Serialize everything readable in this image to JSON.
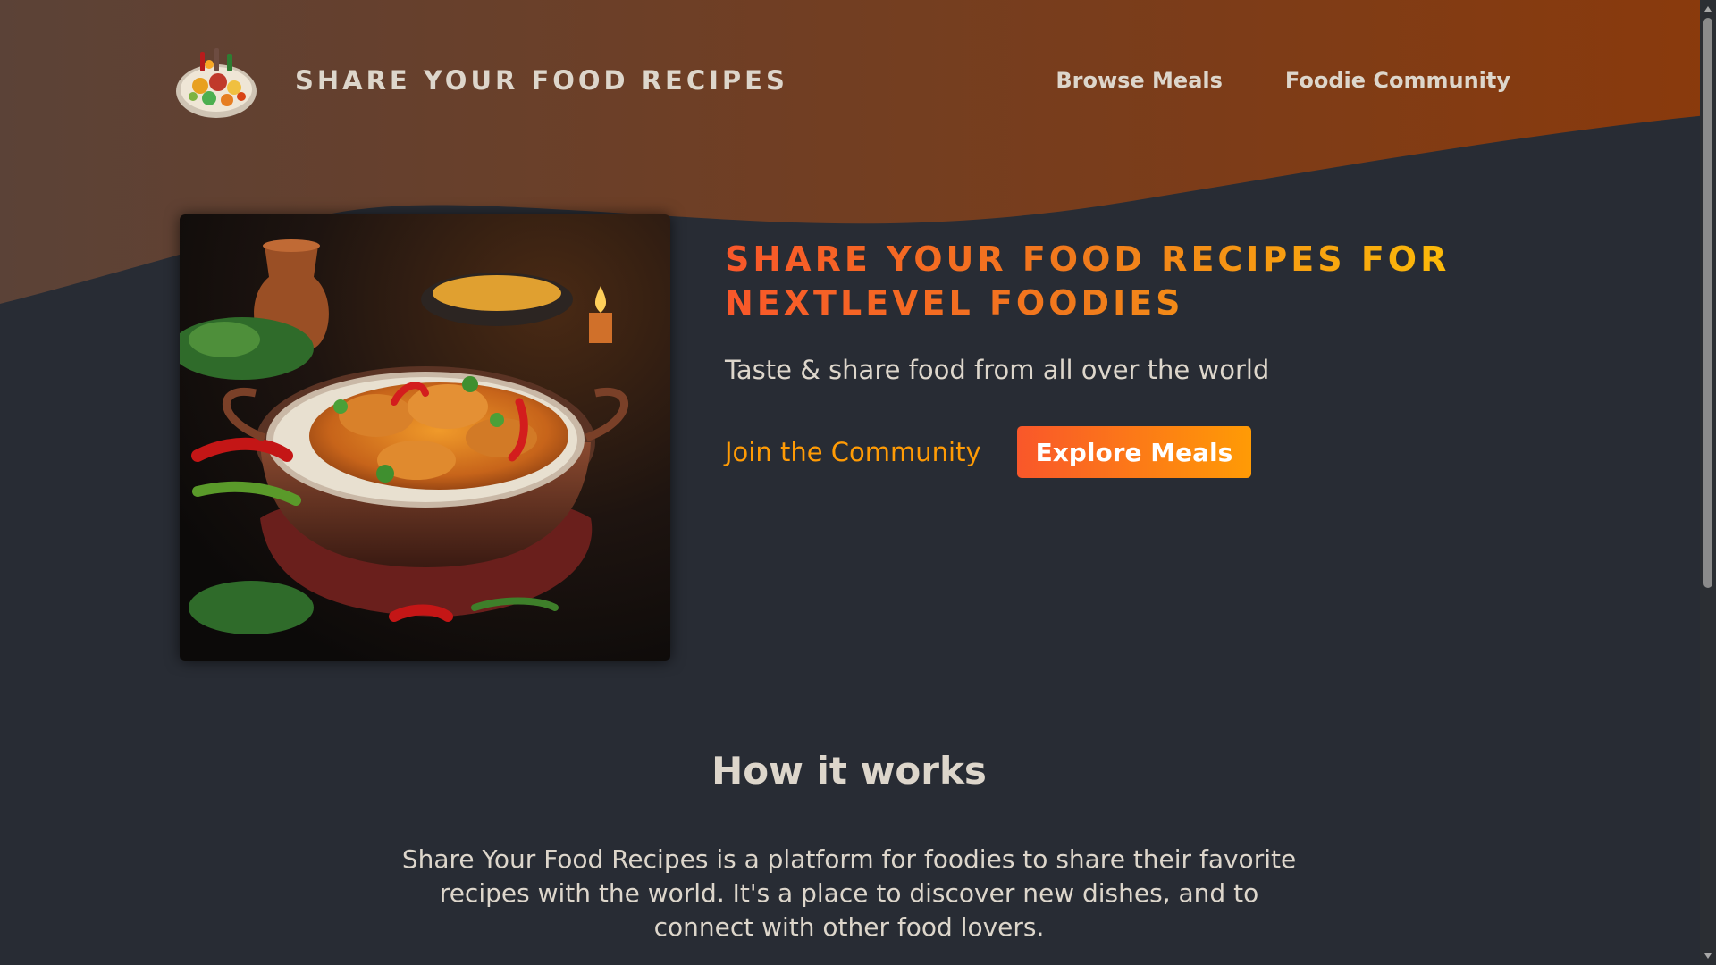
{
  "header": {
    "logo_alt": "A plate with food on it",
    "logo_text": "SHARE YOUR FOOD RECIPES",
    "nav": [
      {
        "label": "Browse Meals"
      },
      {
        "label": "Foodie Community"
      }
    ]
  },
  "hero": {
    "image_alt": "A bowl of curry with chicken and rice",
    "title": "SHARE YOUR FOOD RECIPES FOR NEXTLEVEL FOODIES",
    "subtitle": "Taste & share food from all over the world",
    "cta_link": "Join the Community",
    "cta_button": "Explore Meals"
  },
  "how_it_works": {
    "title": "How it works",
    "body": "Share Your Food Recipes is a platform for foodies to share their favorite recipes with the world. It's a place to discover new dishes, and to connect with other food lovers."
  },
  "colors": {
    "background": "#282c34",
    "header_gradient_start": "#5b4237",
    "header_gradient_end": "#8a3a0c",
    "accent_orange": "#ff9b05",
    "accent_red": "#f9572a",
    "accent_yellow": "#ffc905",
    "text": "#ddd6cb"
  }
}
